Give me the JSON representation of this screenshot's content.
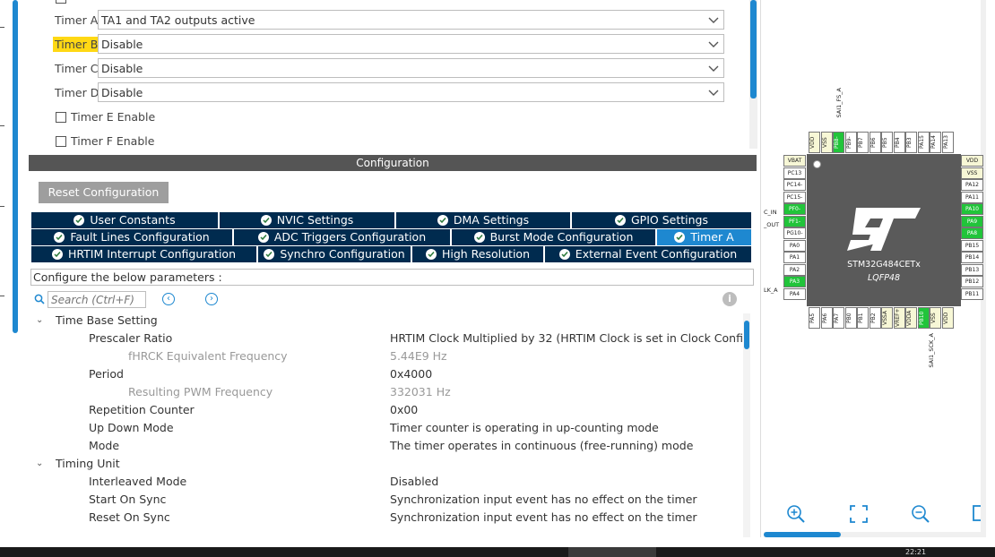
{
  "top_panel": {
    "rows": [
      {
        "label": "Timer A",
        "value": "TA1 and TA2 outputs active"
      },
      {
        "label": "Timer B",
        "value": "Disable"
      },
      {
        "label": "Timer C",
        "value": "Disable"
      },
      {
        "label": "Timer D",
        "value": "Disable"
      }
    ],
    "checkboxes": [
      {
        "label": "Timer E Enable"
      },
      {
        "label": "Timer F Enable"
      }
    ]
  },
  "config": {
    "header": "Configuration",
    "reset_button": "Reset Configuration",
    "tabs_row1": [
      {
        "label": "User Constants"
      },
      {
        "label": "NVIC Settings"
      },
      {
        "label": "DMA Settings"
      },
      {
        "label": "GPIO Settings"
      }
    ],
    "tabs_row2": [
      {
        "label": "Fault Lines Configuration"
      },
      {
        "label": "ADC Triggers Configuration"
      },
      {
        "label": "Burst Mode Configuration"
      },
      {
        "label": "Timer A"
      }
    ],
    "tabs_row3": [
      {
        "label": "HRTIM Interrupt Configuration"
      },
      {
        "label": "Synchro Configuration"
      },
      {
        "label": "High Resolution"
      },
      {
        "label": "External Event Configuration"
      }
    ],
    "hint": "Configure the below parameters :",
    "search_placeholder": "Search (Ctrl+F)",
    "sections": [
      {
        "title": "Time Base Setting"
      },
      {
        "title": "Timing Unit"
      }
    ],
    "params": [
      {
        "name": "Prescaler Ratio",
        "value": "HRTIM Clock Multiplied by 32 (HRTIM Clock is set in Clock Confi..."
      },
      {
        "name": "fHRCK Equivalent Frequency",
        "value": "5.44E9 Hz"
      },
      {
        "name": "Period",
        "value": "0x4000"
      },
      {
        "name": "Resulting PWM Frequency",
        "value": "332031 Hz"
      },
      {
        "name": "Repetition Counter",
        "value": "0x00"
      },
      {
        "name": "Up Down Mode",
        "value": "Timer counter is operating in up-counting mode"
      },
      {
        "name": "Mode",
        "value": "The timer operates in continuous (free-running) mode"
      },
      {
        "name": "Interleaved Mode",
        "value": "Disabled"
      },
      {
        "name": "Start On Sync",
        "value": "Synchronization input event has no effect on the timer"
      },
      {
        "name": "Reset On Sync",
        "value": "Synchronization input event has no effect on the timer"
      }
    ]
  },
  "chip": {
    "part": "STM32G484CETx",
    "package": "LQFP48",
    "top_pins": [
      "VDD",
      "VSS",
      "PB8-",
      "PB9-",
      "PB7",
      "PB6",
      "PB5",
      "PB4",
      "PB3",
      "PA15",
      "PA14",
      "PA13"
    ],
    "bottom_pins": [
      "PA5",
      "PA6",
      "PA7",
      "PB0",
      "PB1",
      "PB2",
      "VSSA",
      "VREF+",
      "VDDA",
      "PB10",
      "VSS",
      "VDD"
    ],
    "left_pins": [
      "VBAT",
      "PC13",
      "PC14-",
      "PC15-",
      "PF0-",
      "PF1-",
      "PG10-",
      "PA0",
      "PA1",
      "PA2",
      "PA3",
      "PA4"
    ],
    "right_pins": [
      "VDD",
      "VSS",
      "PA12",
      "PA11",
      "PA10",
      "PA9",
      "PA8",
      "PB15",
      "PB14",
      "PB13",
      "PB12",
      "PB11"
    ],
    "ext_labels": {
      "top": "SAI1_FS_A",
      "bottom": "SAI1_SCK_A",
      "left1": "C_IN",
      "left2": "_OUT",
      "left3": "LK_A"
    }
  },
  "taskbar": {
    "clock": "22:21"
  },
  "colors": {
    "accent": "#1e88d0",
    "tab_bg": "#002b4f",
    "highlight": "#ffd814",
    "pin_green": "#21c43a"
  }
}
